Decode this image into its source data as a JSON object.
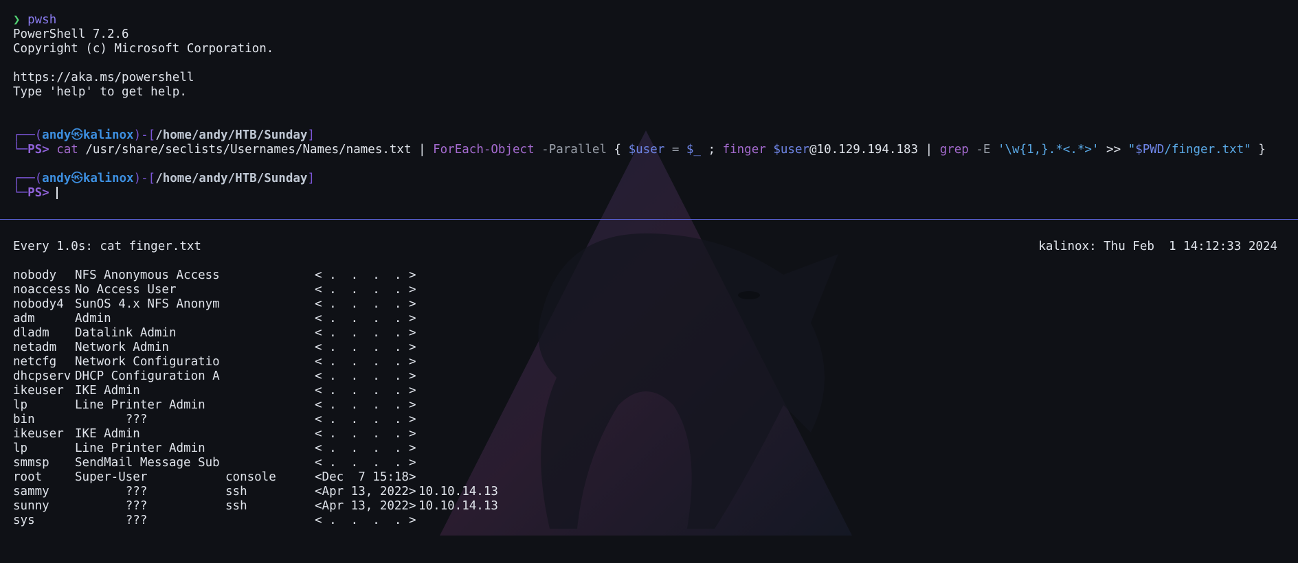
{
  "startup": {
    "prompt_glyph": "❯",
    "command": "pwsh",
    "lines": [
      "PowerShell 7.2.6",
      "Copyright (c) Microsoft Corporation.",
      "",
      "https://aka.ms/powershell",
      "Type 'help' to get help."
    ]
  },
  "prompt1": {
    "box_top": "┌──(",
    "user": "andy",
    "at": "㉿",
    "host": "kalinox",
    "mid": ")-[",
    "path": "/home/andy/HTB/Sunday",
    "close": "]",
    "box_bottom": "└─",
    "ps": "PS>",
    "tokens": [
      {
        "t": "cat",
        "c": "kw"
      },
      {
        "t": " /usr/share/seclists/Usernames/Names/names.txt | ",
        "c": "plain"
      },
      {
        "t": "ForEach-Object",
        "c": "kw"
      },
      {
        "t": " -Parallel",
        "c": "param"
      },
      {
        "t": " { ",
        "c": "plain"
      },
      {
        "t": "$user",
        "c": "var"
      },
      {
        "t": " = ",
        "c": "op"
      },
      {
        "t": "$_",
        "c": "var"
      },
      {
        "t": " ; ",
        "c": "plain"
      },
      {
        "t": "finger",
        "c": "kw"
      },
      {
        "t": " ",
        "c": "plain"
      },
      {
        "t": "$user",
        "c": "var"
      },
      {
        "t": "@10.129.194.183 | ",
        "c": "plain"
      },
      {
        "t": "grep",
        "c": "kw"
      },
      {
        "t": " -E",
        "c": "param"
      },
      {
        "t": " '\\w{1,}.*<.*>'",
        "c": "str"
      },
      {
        "t": " >> ",
        "c": "plain"
      },
      {
        "t": "\"",
        "c": "str"
      },
      {
        "t": "$PWD",
        "c": "strvar"
      },
      {
        "t": "/finger.txt\"",
        "c": "str"
      },
      {
        "t": " }",
        "c": "plain"
      }
    ]
  },
  "prompt2": {
    "box_top": "┌──(",
    "user": "andy",
    "at": "㉿",
    "host": "kalinox",
    "mid": ")-[",
    "path": "/home/andy/HTB/Sunday",
    "close": "]",
    "box_bottom": "└─",
    "ps": "PS>"
  },
  "watch": {
    "header_left": "Every 1.0s: cat finger.txt",
    "header_right": "kalinox: Thu Feb  1 14:12:33 2024",
    "rows": [
      {
        "login": "nobody",
        "name": "NFS Anonymous Access",
        "tty": "",
        "idle": "< .  .  .  . >",
        "where": ""
      },
      {
        "login": "noaccess",
        "name": "No Access User",
        "tty": "",
        "idle": "< .  .  .  . >",
        "where": ""
      },
      {
        "login": "nobody4",
        "name": "SunOS 4.x NFS Anonym",
        "tty": "",
        "idle": "< .  .  .  . >",
        "where": ""
      },
      {
        "login": "adm",
        "name": "Admin",
        "tty": "",
        "idle": "< .  .  .  . >",
        "where": ""
      },
      {
        "login": "dladm",
        "name": "Datalink Admin",
        "tty": "",
        "idle": "< .  .  .  . >",
        "where": ""
      },
      {
        "login": "netadm",
        "name": "Network Admin",
        "tty": "",
        "idle": "< .  .  .  . >",
        "where": ""
      },
      {
        "login": "netcfg",
        "name": "Network Configuratio",
        "tty": "",
        "idle": "< .  .  .  . >",
        "where": ""
      },
      {
        "login": "dhcpserv",
        "name": "DHCP Configuration A",
        "tty": "",
        "idle": "< .  .  .  . >",
        "where": ""
      },
      {
        "login": "ikeuser",
        "name": "IKE Admin",
        "tty": "",
        "idle": "< .  .  .  . >",
        "where": ""
      },
      {
        "login": "lp",
        "name": "Line Printer Admin",
        "tty": "",
        "idle": "< .  .  .  . >",
        "where": ""
      },
      {
        "login": "bin",
        "name": "       ???",
        "tty": "",
        "idle": "< .  .  .  . >",
        "where": ""
      },
      {
        "login": "ikeuser",
        "name": "IKE Admin",
        "tty": "",
        "idle": "< .  .  .  . >",
        "where": ""
      },
      {
        "login": "lp",
        "name": "Line Printer Admin",
        "tty": "",
        "idle": "< .  .  .  . >",
        "where": ""
      },
      {
        "login": "smmsp",
        "name": "SendMail Message Sub",
        "tty": "",
        "idle": "< .  .  .  . >",
        "where": ""
      },
      {
        "login": "root",
        "name": "Super-User",
        "tty": "console",
        "idle": "<Dec  7 15:18>",
        "where": ""
      },
      {
        "login": "sammy",
        "name": "       ???",
        "tty": "ssh",
        "idle": "<Apr 13, 2022>",
        "where": "10.10.14.13"
      },
      {
        "login": "sunny",
        "name": "       ???",
        "tty": "ssh",
        "idle": "<Apr 13, 2022>",
        "where": "10.10.14.13"
      },
      {
        "login": "sys",
        "name": "       ???",
        "tty": "",
        "idle": "< .  .  .  . >",
        "where": ""
      }
    ]
  },
  "colors": {
    "background": "#0f1116",
    "divider": "#5b63d8",
    "prompt_user": "#3d8fe0",
    "ps_prompt": "#8f62d8"
  },
  "icons": {
    "background_logo": "kali-dragon-logo"
  }
}
